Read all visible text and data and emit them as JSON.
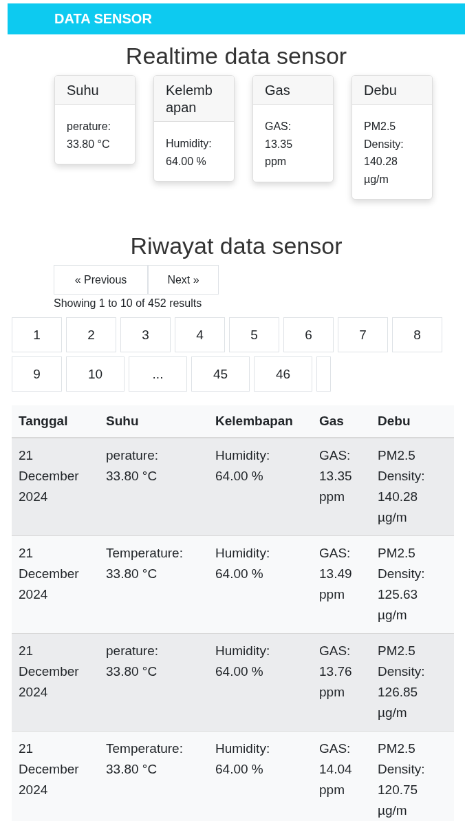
{
  "navbar": {
    "brand": "DATA SENSOR"
  },
  "realtime": {
    "title": "Realtime data sensor",
    "cards": [
      {
        "header": "Suhu",
        "lines": [
          "perature:",
          "33.80 °C"
        ]
      },
      {
        "header": "Kelemb apan",
        "lines": [
          "Humidity:",
          "64.00 %"
        ]
      },
      {
        "header": "Gas",
        "lines": [
          "GAS:",
          "13.35",
          "ppm"
        ]
      },
      {
        "header": "Debu",
        "lines": [
          "PM2.5",
          "Density:",
          "140.28",
          "µg/m"
        ]
      }
    ]
  },
  "history": {
    "title": "Riwayat data sensor",
    "prev": "« Previous",
    "next": "Next »",
    "summary": "Showing 1 to 10 of 452 results",
    "pages": [
      {
        "label": "1"
      },
      {
        "label": "2"
      },
      {
        "label": "3"
      },
      {
        "label": "4"
      },
      {
        "label": "5"
      },
      {
        "label": "6"
      },
      {
        "label": "7"
      },
      {
        "label": "8"
      },
      {
        "label": "9"
      },
      {
        "label": "10"
      },
      {
        "label": "..."
      },
      {
        "label": "45"
      },
      {
        "label": "46"
      }
    ],
    "table": {
      "columns": [
        "Tanggal",
        "Suhu",
        "Kelembapan",
        "Gas",
        "Debu"
      ],
      "rows": [
        [
          "21\nDecember\n2024",
          "perature:\n33.80 °C",
          "Humidity:\n64.00 %",
          "GAS:\n13.35\nppm",
          "PM2.5\nDensity:\n140.28\nµg/m"
        ],
        [
          "21\nDecember\n2024",
          "Temperature:\n33.80 °C",
          "Humidity:\n64.00 %",
          "GAS:\n13.49\nppm",
          "PM2.5\nDensity:\n125.63\nµg/m"
        ],
        [
          "21\nDecember\n2024",
          "perature:\n33.80 °C",
          "Humidity:\n64.00 %",
          "GAS:\n13.76\nppm",
          "PM2.5\nDensity:\n126.85\nµg/m"
        ],
        [
          "21\nDecember\n2024",
          "Temperature:\n33.80 °C",
          "Humidity:\n64.00 %",
          "GAS:\n14.04\nppm",
          "PM2.5\nDensity:\n120.75\nµg/m"
        ]
      ]
    }
  }
}
